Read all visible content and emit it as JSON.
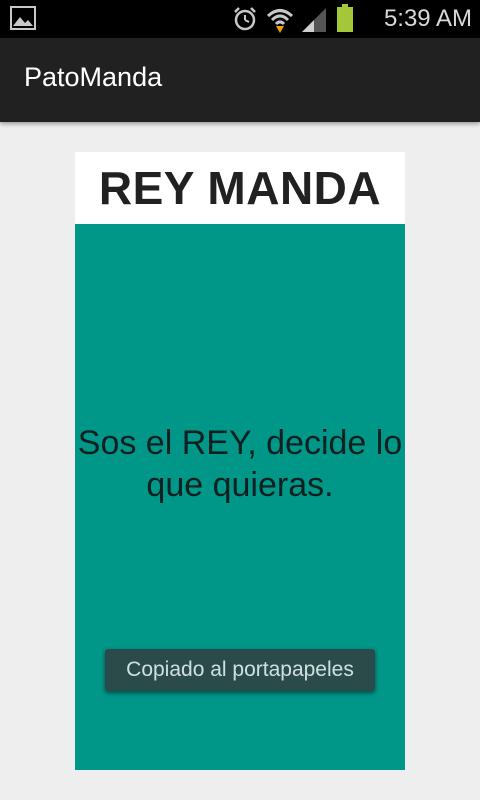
{
  "status_bar": {
    "time": "5:39 AM",
    "icons": [
      "gallery-notification-icon",
      "alarm-icon",
      "wifi-icon",
      "signal-icon",
      "battery-icon"
    ],
    "battery_color": "#a4c639"
  },
  "app_bar": {
    "title": "PatoManda"
  },
  "card": {
    "title": "REY MANDA",
    "message": "Sos el REY, decide lo que quieras.",
    "background": "#009688"
  },
  "toast": {
    "text": "Copiado al portapapeles"
  }
}
